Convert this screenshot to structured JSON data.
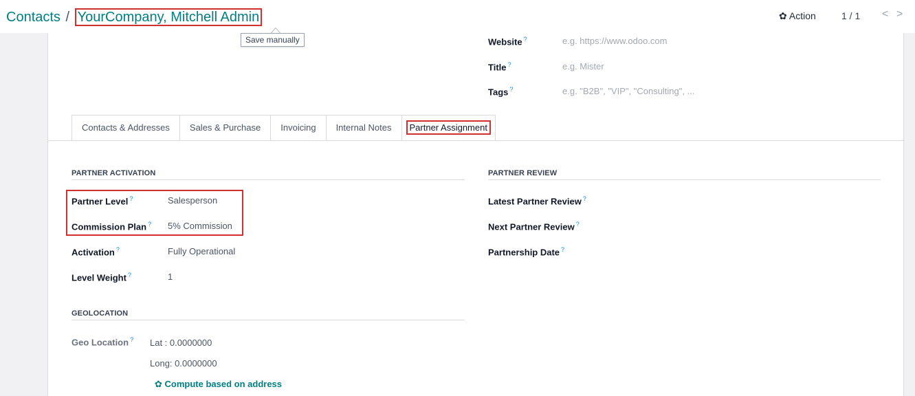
{
  "breadcrumb": {
    "parent": "Contacts",
    "separator": "/",
    "current": "YourCompany, Mitchell Admin"
  },
  "tooltip": "Save manually",
  "toolbar": {
    "action_label": "Action",
    "pager": "1 / 1",
    "prev": "<",
    "next": ">"
  },
  "top_fields": [
    {
      "label": "Website",
      "placeholder": "e.g. https://www.odoo.com"
    },
    {
      "label": "Title",
      "placeholder": "e.g. Mister"
    },
    {
      "label": "Tags",
      "placeholder": "e.g. \"B2B\", \"VIP\", \"Consulting\", ..."
    }
  ],
  "tabs": [
    "Contacts & Addresses",
    "Sales & Purchase",
    "Invoicing",
    "Internal Notes",
    "Partner Assignment"
  ],
  "partner_activation": {
    "title": "PARTNER ACTIVATION",
    "fields": [
      {
        "label": "Partner Level",
        "value": "Salesperson"
      },
      {
        "label": "Commission Plan",
        "value": "5% Commission"
      },
      {
        "label": "Activation",
        "value": "Fully Operational"
      },
      {
        "label": "Level Weight",
        "value": "1"
      }
    ]
  },
  "partner_review": {
    "title": "PARTNER REVIEW",
    "fields": [
      {
        "label": "Latest Partner Review"
      },
      {
        "label": "Next Partner Review"
      },
      {
        "label": "Partnership Date"
      }
    ]
  },
  "geolocation": {
    "title": "GEOLOCATION",
    "label": "Geo Location",
    "lat": "Lat : 0.0000000",
    "long": "Long: 0.0000000",
    "compute_label": "Compute based on address"
  },
  "help_mark": "?",
  "icons": {
    "action": "gear-icon",
    "compute": "gear-icon"
  },
  "colors": {
    "link": "#017e84",
    "highlight": "#d32f2f",
    "help": "#0d8bf2"
  }
}
